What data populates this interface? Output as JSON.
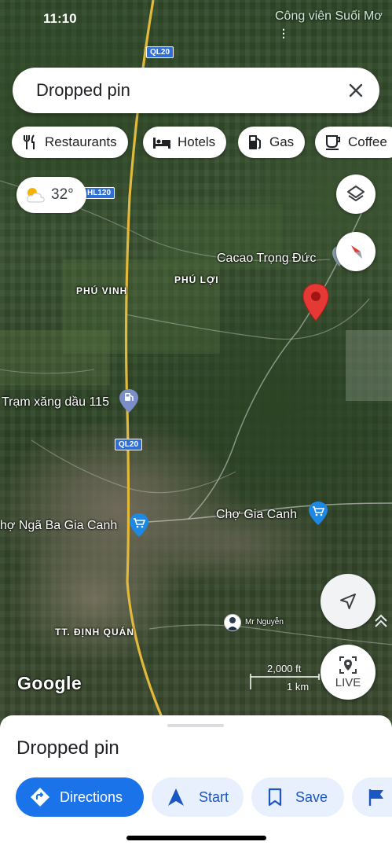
{
  "status_bar": {
    "time": "11:10"
  },
  "search": {
    "value": "Dropped pin"
  },
  "chips": [
    {
      "label": "Restaurants",
      "icon": "fork-knife-icon"
    },
    {
      "label": "Hotels",
      "icon": "bed-icon"
    },
    {
      "label": "Gas",
      "icon": "gas-station-icon"
    },
    {
      "label": "Coffee",
      "icon": "coffee-cup-icon"
    }
  ],
  "weather": {
    "temperature": "32°",
    "icon": "partly-cloudy-icon"
  },
  "map": {
    "top_place": "Công viên Suối Mơ",
    "road_shields": [
      "QL20",
      "HL120",
      "QL20"
    ],
    "labels": {
      "cacao": "Cacao Trọng Đức",
      "phu_vinh": "PHÚ VINH",
      "phu_loi": "PHÚ LỢI",
      "gas_station": "Trạm xăng dầu 115",
      "market_nga_ba": "hợ Ngã Ba Gia Canh",
      "market_gia_canh": "Chợ Gia Canh",
      "dinh_quan": "TT. ĐỊNH QUÁN",
      "user": "Mr Nguyễn"
    },
    "scale": {
      "imperial": "2,000 ft",
      "metric": "1 km"
    },
    "live_label": "LIVE",
    "logo": "Google",
    "colors": {
      "pin": "#e53935",
      "shield": "#2f6fd6",
      "road": "#e2b93b"
    }
  },
  "sheet": {
    "title": "Dropped pin",
    "actions": [
      {
        "label": "Directions",
        "icon": "directions-icon"
      },
      {
        "label": "Start",
        "icon": "navigation-arrow-icon"
      },
      {
        "label": "Save",
        "icon": "bookmark-icon"
      },
      {
        "label": "",
        "icon": "flag-icon"
      }
    ]
  },
  "colors": {
    "accent": "#1a73e8",
    "secondary_bg": "#e8f0fe"
  }
}
